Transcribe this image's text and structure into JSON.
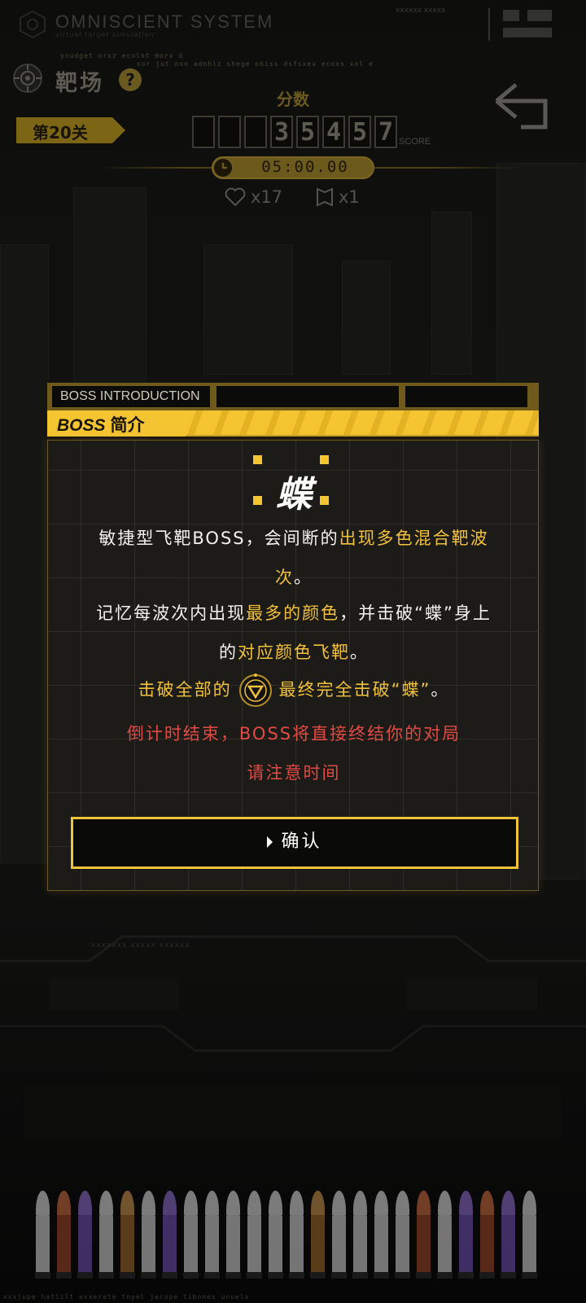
{
  "top_bar": {
    "system_title": "OMNISCIENT SYSTEM",
    "system_subtitle": "virtual target simulation",
    "code": "xxxxxx xxxxx",
    "ticker_1": "youdget orxz ecolnt morx d",
    "ticker_2": "xor jut oxo adnhlz shege okiss dsfsxex ecoxs xol e"
  },
  "header": {
    "title": "靶场",
    "level": "第20关",
    "score_label": "分数",
    "score_digits": [
      "",
      "",
      "",
      "3",
      "5",
      "4",
      "5",
      "7"
    ],
    "score_unit": "SCORE",
    "timer": "05:00.00",
    "lives": "x17",
    "shields": "x1"
  },
  "modal": {
    "header_en": "BOSS INTRODUCTION",
    "header_boss": "BOSS",
    "header_cn": "简介",
    "boss_name": "蝶",
    "para1_a": "敏捷型飞靶BOSS，会间断的",
    "para1_b": "出现多色混合靶波",
    "para1_c": "次",
    "para1_d": "。",
    "para2_a": "记忆每波次内出现",
    "para2_b": "最多的颜色",
    "para2_c": "，并击破“蝶”身上",
    "para2_d": "的",
    "para2_e": "对应颜色飞靶",
    "para2_f": "。",
    "para3_a": "击破全部的",
    "para3_b": "最终完全击破“蝶”",
    "para3_c": "。",
    "warn_1": "倒计时结束，BOSS将直接终结你的对局",
    "warn_2": "请注意时间",
    "confirm_label": "确认"
  },
  "lower": {
    "code": "xxxxxxx xxxxx xxxxxx"
  },
  "ammo": {
    "bullets": [
      {
        "tip": "#d9d9d9",
        "case": "#cfcfcf"
      },
      {
        "tip": "#c86a3c",
        "case": "#9b4426"
      },
      {
        "tip": "#8d6ccc",
        "case": "#6e4fb0"
      },
      {
        "tip": "#d9d9d9",
        "case": "#cfcfcf"
      },
      {
        "tip": "#c8924c",
        "case": "#9c6a2a"
      },
      {
        "tip": "#d9d9d9",
        "case": "#cfcfcf"
      },
      {
        "tip": "#8d6ccc",
        "case": "#6e4fb0"
      },
      {
        "tip": "#d9d9d9",
        "case": "#cfcfcf"
      },
      {
        "tip": "#d9d9d9",
        "case": "#cfcfcf"
      },
      {
        "tip": "#d9d9d9",
        "case": "#cfcfcf"
      },
      {
        "tip": "#d9d9d9",
        "case": "#cfcfcf"
      },
      {
        "tip": "#d9d9d9",
        "case": "#cfcfcf"
      },
      {
        "tip": "#d9d9d9",
        "case": "#cfcfcf"
      },
      {
        "tip": "#c8924c",
        "case": "#9c6a2a"
      },
      {
        "tip": "#d9d9d9",
        "case": "#cfcfcf"
      },
      {
        "tip": "#d9d9d9",
        "case": "#cfcfcf"
      },
      {
        "tip": "#d9d9d9",
        "case": "#cfcfcf"
      },
      {
        "tip": "#d9d9d9",
        "case": "#cfcfcf"
      },
      {
        "tip": "#c86a3c",
        "case": "#9b4426"
      },
      {
        "tip": "#d9d9d9",
        "case": "#cfcfcf"
      },
      {
        "tip": "#8d6ccc",
        "case": "#6e4fb0"
      },
      {
        "tip": "#c86a3c",
        "case": "#9b4426"
      },
      {
        "tip": "#8d6ccc",
        "case": "#6e4fb0"
      },
      {
        "tip": "#d9d9d9",
        "case": "#cfcfcf"
      }
    ],
    "bottom_ticker": "xxxjupe hatlilt exxerate tnyel jerope tibonex unuelx"
  },
  "colors": {
    "accent_gold": "#f1c13a",
    "warning_red": "#e24a44"
  }
}
